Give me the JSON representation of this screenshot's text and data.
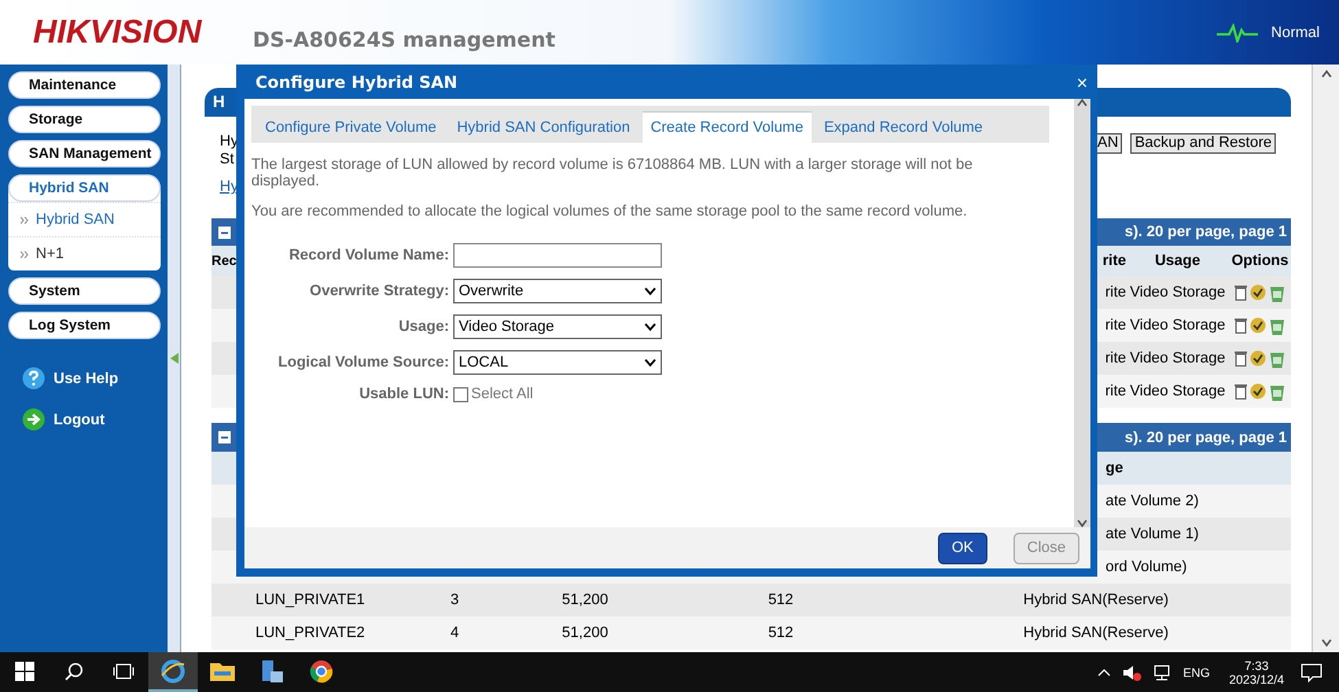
{
  "header": {
    "logo": "HIKVISION",
    "title": "DS-A80624S management",
    "status": "Normal"
  },
  "sidebar": {
    "items": [
      {
        "label": "Maintenance",
        "selected": false
      },
      {
        "label": "Storage",
        "selected": false
      },
      {
        "label": "SAN Management",
        "selected": false
      },
      {
        "label": "Hybrid SAN",
        "selected": true,
        "children": [
          {
            "label": "Hybrid SAN",
            "selected": true
          },
          {
            "label": "N+1",
            "selected": false
          }
        ]
      },
      {
        "label": "System",
        "selected": false
      },
      {
        "label": "Log System",
        "selected": false
      }
    ],
    "links": [
      {
        "kind": "help",
        "label": "Use Help"
      },
      {
        "kind": "logout",
        "label": "Logout"
      }
    ]
  },
  "page": {
    "tab_title": "H",
    "intro_lines": [
      "Hy",
      "St"
    ],
    "link": "Hy",
    "buttons": [
      "AN",
      "Backup and Restore"
    ],
    "table1": {
      "header_text": "s). 20 per page, page 1",
      "columns": [
        "Rec",
        "rite",
        "Usage",
        "Options"
      ],
      "rows": [
        {
          "cells": [
            "",
            "rite",
            "Video Storage"
          ]
        },
        {
          "cells": [
            "",
            "rite",
            "Video Storage"
          ]
        },
        {
          "cells": [
            "",
            "rite",
            "Video Storage"
          ]
        },
        {
          "cells": [
            "",
            "rite",
            "Video Storage"
          ]
        }
      ]
    },
    "table2": {
      "header_text": "s). 20 per page, page 1",
      "columns": [
        "ge"
      ],
      "rows": [
        {
          "kind": "partial",
          "cells": [
            "ate Volume 2)"
          ]
        },
        {
          "kind": "partial",
          "cells": [
            "ate Volume 1)"
          ]
        },
        {
          "kind": "partial",
          "cells": [
            "ord Volume)"
          ]
        },
        {
          "kind": "full",
          "cells": [
            "LUN_PRIVATE1",
            "3",
            "51,200",
            "512",
            "Hybrid SAN(Reserve)"
          ]
        },
        {
          "kind": "full",
          "cells": [
            "LUN_PRIVATE2",
            "4",
            "51,200",
            "512",
            "Hybrid SAN(Reserve)"
          ]
        }
      ]
    }
  },
  "dialog": {
    "title": "Configure Hybrid SAN",
    "close": "×",
    "tabs": [
      {
        "label": "Configure Private Volume",
        "selected": false
      },
      {
        "label": "Hybrid SAN Configuration",
        "selected": false
      },
      {
        "label": "Create Record Volume",
        "selected": true
      },
      {
        "label": "Expand Record Volume",
        "selected": false
      }
    ],
    "notes": [
      "The largest storage of LUN allowed by record volume is 67108864 MB. LUN with a larger storage will not be displayed.",
      "You are recommended to allocate the logical volumes of the same storage pool to the same record volume."
    ],
    "fields": [
      {
        "kind": "text",
        "label": "Record Volume Name:"
      },
      {
        "kind": "select",
        "label": "Overwrite Strategy:",
        "value": "Overwrite"
      },
      {
        "kind": "select",
        "label": "Usage:",
        "value": "Video Storage"
      },
      {
        "kind": "select",
        "label": "Logical Volume Source:",
        "value": "LOCAL"
      },
      {
        "kind": "checkbox",
        "label": "Usable LUN:",
        "value": "Select All",
        "checked": false
      }
    ],
    "buttons": [
      {
        "kind": "primary",
        "label": "OK"
      },
      {
        "kind": "secondary",
        "label": "Close"
      }
    ]
  },
  "taskbar": {
    "apps": [
      {
        "kind": "browser-e",
        "selected": true
      },
      {
        "kind": "folder",
        "selected": false
      },
      {
        "kind": "server",
        "selected": false
      },
      {
        "kind": "chrome",
        "selected": false
      }
    ],
    "language": "ENG",
    "time": "7:33",
    "date": "2023/12/4"
  }
}
